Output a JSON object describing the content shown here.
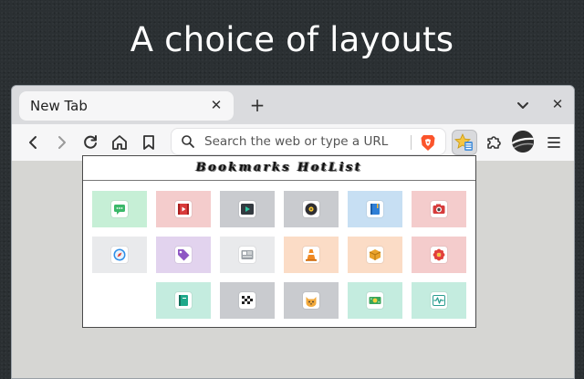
{
  "headline": "A choice of layouts",
  "tab": {
    "title": "New Tab",
    "close_glyph": "✕"
  },
  "new_tab_glyph": "+",
  "window_close_glyph": "✕",
  "urlbar": {
    "placeholder": "Search the web or type a URL",
    "value": ""
  },
  "popup": {
    "title": "Bookmarks HotList",
    "tiles": [
      {
        "bg": "#c6efd6",
        "icon": "chat-icon"
      },
      {
        "bg": "#f4cccc",
        "icon": "video-player-icon"
      },
      {
        "bg": "#c9cbcf",
        "icon": "media-play-icon"
      },
      {
        "bg": "#c9cbcf",
        "icon": "disc-icon"
      },
      {
        "bg": "#c7dff3",
        "icon": "book-icon"
      },
      {
        "bg": "#f4cccc",
        "icon": "camera-icon"
      },
      {
        "bg": "#e9eaec",
        "icon": "compass-icon"
      },
      {
        "bg": "#e2d3ee",
        "icon": "tag-icon"
      },
      {
        "bg": "#e9eaec",
        "icon": "newspaper-icon"
      },
      {
        "bg": "#fbdcc6",
        "icon": "traffic-cone-icon"
      },
      {
        "bg": "#fbdcc6",
        "icon": "box-icon"
      },
      {
        "bg": "#f4cccc",
        "icon": "flower-icon"
      },
      {
        "bg": "#c4ecdf",
        "icon": "notebook-icon"
      },
      {
        "bg": "#c9cbcf",
        "icon": "checkered-flag-icon"
      },
      {
        "bg": "#c9cbcf",
        "icon": "cat-face-icon"
      },
      {
        "bg": "#c4ecdf",
        "icon": "money-icon"
      },
      {
        "bg": "#c4ecdf",
        "icon": "activity-monitor-icon"
      }
    ]
  },
  "colors": {
    "page_bg": "#2b3033",
    "browser_chrome": "#dadbde",
    "toolbar": "#f6f6f7",
    "brave_orange": "#fb542b"
  }
}
